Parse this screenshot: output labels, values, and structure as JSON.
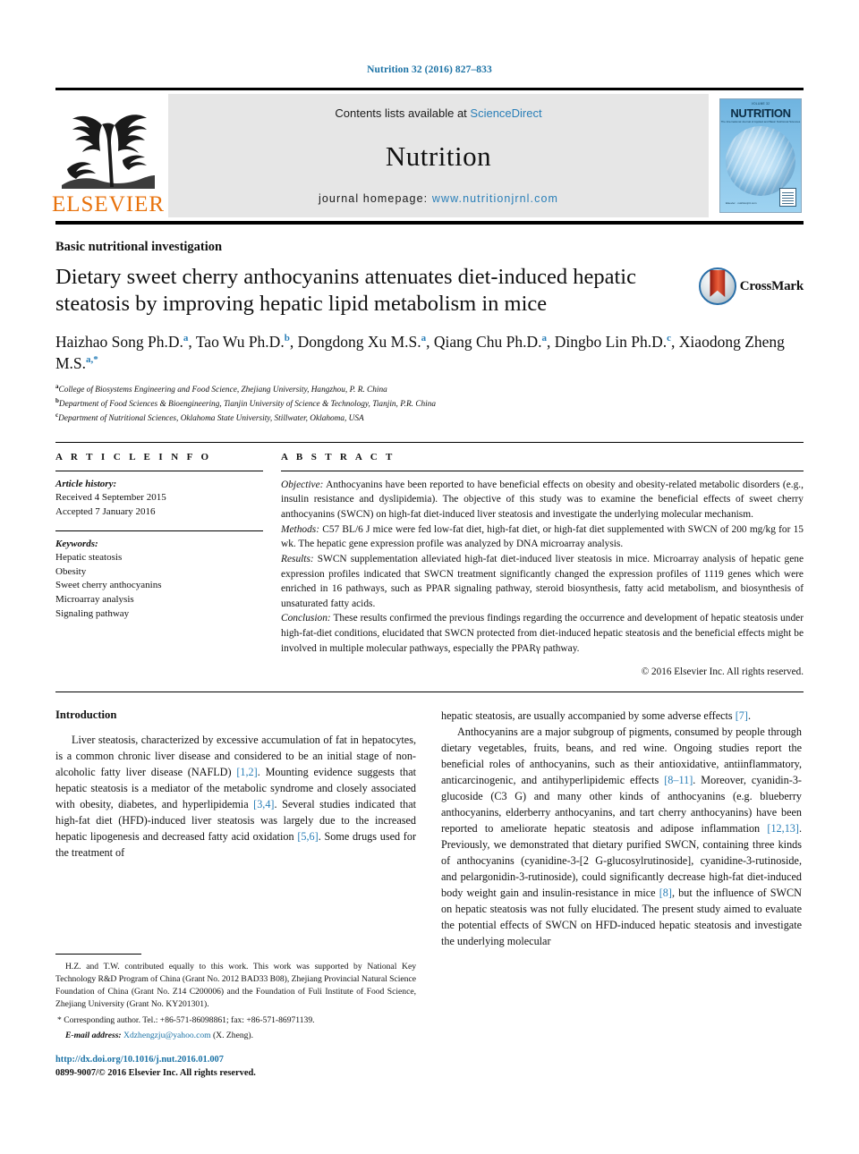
{
  "running_head": "Nutrition 32 (2016) 827–833",
  "banner": {
    "publisher_name": "ELSEVIER",
    "contents_prefix": "Contents lists available at ",
    "contents_link": "ScienceDirect",
    "journal_name": "Nutrition",
    "homepage_prefix": "journal homepage: ",
    "homepage_url": "www.nutritionjrnl.com",
    "cover": {
      "volume_line": "VOLUME 32",
      "masthead": "NUTRITION",
      "subtitle": "The International Journal of Applied and Basic Nutritional Sciences",
      "footer": "Elsevier · nutritionjrnl.com"
    }
  },
  "article": {
    "section_label": "Basic nutritional investigation",
    "title": "Dietary sweet cherry anthocyanins attenuates diet-induced hepatic steatosis by improving hepatic lipid metabolism in mice",
    "crossmark_label": "CrossMark",
    "authors": [
      {
        "name": "Haizhao Song Ph.D.",
        "marks": "a",
        "sep": ", "
      },
      {
        "name": "Tao Wu Ph.D.",
        "marks": "b",
        "sep": ", "
      },
      {
        "name": "Dongdong Xu M.S.",
        "marks": "a",
        "sep": ", "
      },
      {
        "name": "Qiang Chu Ph.D.",
        "marks": "a",
        "sep": ", "
      },
      {
        "name": "Dingbo Lin Ph.D.",
        "marks": "c",
        "sep": ", "
      },
      {
        "name": "Xiaodong Zheng M.S.",
        "marks": "a,*",
        "sep": ""
      }
    ],
    "affiliations": [
      {
        "sup": "a",
        "text": "College of Biosystems Engineering and Food Science, Zhejiang University, Hangzhou, P. R. China"
      },
      {
        "sup": "b",
        "text": "Department of Food Sciences & Bioengineering, Tianjin University of Science & Technology, Tianjin, P.R. China"
      },
      {
        "sup": "c",
        "text": "Department of Nutritional Sciences, Oklahoma State University, Stillwater, Oklahoma, USA"
      }
    ]
  },
  "article_info": {
    "heading": "A R T I C L E  I N F O",
    "history_label": "Article history:",
    "received": "Received 4 September 2015",
    "accepted": "Accepted 7 January 2016",
    "keywords_label": "Keywords:",
    "keywords": [
      "Hepatic steatosis",
      "Obesity",
      "Sweet cherry anthocyanins",
      "Microarray analysis",
      "Signaling pathway"
    ]
  },
  "abstract": {
    "heading": "A B S T R A C T",
    "objective_label": "Objective:",
    "objective_text": " Anthocyanins have been reported to have beneficial effects on obesity and obesity-related metabolic disorders (e.g., insulin resistance and dyslipidemia). The objective of this study was to examine the beneficial effects of sweet cherry anthocyanins (SWCN) on high-fat diet-induced liver steatosis and investigate the underlying molecular mechanism.",
    "methods_label": "Methods:",
    "methods_text": " C57 BL/6 J mice were fed low-fat diet, high-fat diet, or high-fat diet supplemented with SWCN of 200 mg/kg for 15 wk. The hepatic gene expression profile was analyzed by DNA microarray analysis.",
    "results_label": "Results:",
    "results_text": " SWCN supplementation alleviated high-fat diet-induced liver steatosis in mice. Microarray analysis of hepatic gene expression profiles indicated that SWCN treatment significantly changed the expression profiles of 1119 genes which were enriched in 16 pathways, such as PPAR signaling pathway, steroid biosynthesis, fatty acid metabolism, and biosynthesis of unsaturated fatty acids.",
    "conclusion_label": "Conclusion:",
    "conclusion_text": " These results confirmed the previous findings regarding the occurrence and development of hepatic steatosis under high-fat-diet conditions, elucidated that SWCN protected from diet-induced hepatic steatosis and the beneficial effects might be involved in multiple molecular pathways, especially the PPARγ pathway.",
    "copyright": "© 2016 Elsevier Inc. All rights reserved."
  },
  "body": {
    "intro_heading": "Introduction",
    "left_p1_a": "Liver steatosis, characterized by excessive accumulation of fat in hepatocytes, is a common chronic liver disease and considered to be an initial stage of non-alcoholic fatty liver disease (NAFLD) ",
    "left_p1_ref1": "[1,2]",
    "left_p1_b": ". Mounting evidence suggests that hepatic steatosis is a mediator of the metabolic syndrome and closely associated with obesity, diabetes, and hyperlipidemia ",
    "left_p1_ref2": "[3,4]",
    "left_p1_c": ". Several studies indicated that high-fat diet (HFD)-induced liver steatosis was largely due to the increased hepatic lipogenesis and decreased fatty acid oxidation ",
    "left_p1_ref3": "[5,6]",
    "left_p1_d": ". Some drugs used for the treatment of",
    "right_p1_a": "hepatic steatosis, are usually accompanied by some adverse effects ",
    "right_p1_ref": "[7]",
    "right_p1_b": ".",
    "right_p2_a": "Anthocyanins are a major subgroup of pigments, consumed by people through dietary vegetables, fruits, beans, and red wine. Ongoing studies report the beneficial roles of anthocyanins, such as their antioxidative, antiinflammatory, anticarcinogenic, and antihyperlipidemic effects ",
    "right_p2_ref1": "[8–11]",
    "right_p2_b": ". Moreover, cyanidin-3-glucoside (C3 G) and many other kinds of anthocyanins (e.g. blueberry anthocyanins, elderberry anthocyanins, and tart cherry anthocyanins) have been reported to ameliorate hepatic steatosis and adipose inflammation ",
    "right_p2_ref2": "[12,13]",
    "right_p2_c": ". Previously, we demonstrated that dietary purified SWCN, containing three kinds of anthocyanins (cyanidine-3-[2 G-glucosylrutinoside], cyanidine-3-rutinoside, and pelargonidin-3-rutinoside), could significantly decrease high-fat diet-induced body weight gain and insulin-resistance in mice ",
    "right_p2_ref3": "[8]",
    "right_p2_d": ", but the influence of SWCN on hepatic steatosis was not fully elucidated. The present study aimed to evaluate the potential effects of SWCN on HFD-induced hepatic steatosis and investigate the underlying molecular"
  },
  "footnotes": {
    "funding": "H.Z. and T.W. contributed equally to this work. This work was supported by National Key Technology R&D Program of China (Grant No. 2012 BAD33 B08), Zhejiang Provincial Natural Science Foundation of China (Grant No. Z14 C200006) and the Foundation of Fuli Institute of Food Science, Zhejiang University (Grant No. KY201301).",
    "corresponding_star": "*",
    "corresponding": " Corresponding author. Tel.: +86-571-86098861; fax: +86-571-86971139.",
    "email_label": "E-mail address:",
    "email": " Xdzhengzju@yahoo.com",
    "email_suffix": " (X. Zheng).",
    "doi": "http://dx.doi.org/10.1016/j.nut.2016.01.007",
    "issn": "0899-9007/© 2016 Elsevier Inc. All rights reserved."
  },
  "colors": {
    "link": "#1b72a5",
    "reference": "#2a7fb8",
    "elsevier_orange": "#e8720c"
  }
}
